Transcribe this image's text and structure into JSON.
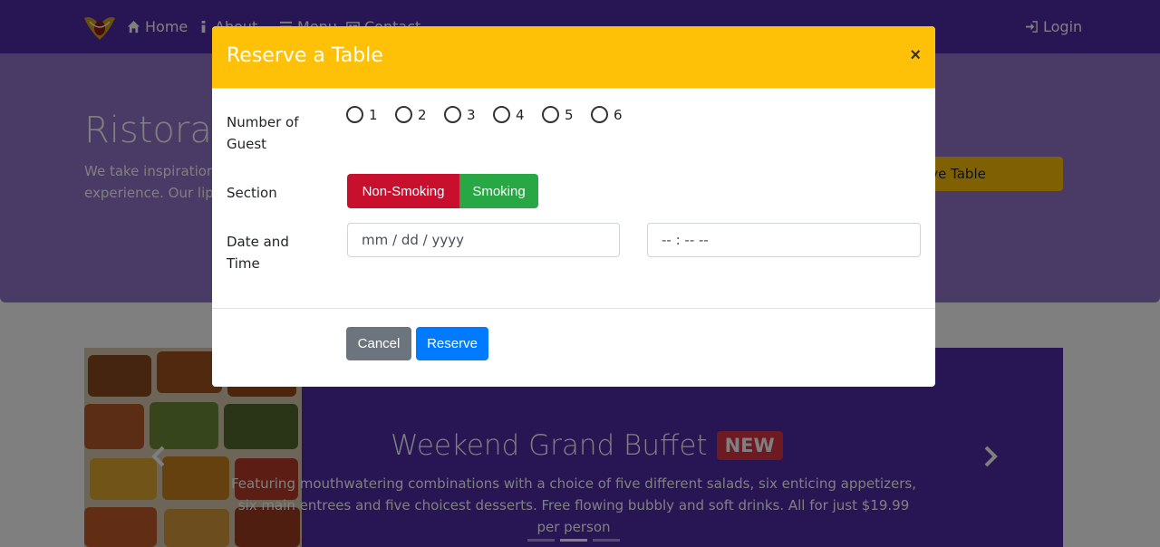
{
  "navbar": {
    "home": "Home",
    "about": "About",
    "menu": "Menu",
    "contact": "Contact",
    "login": "Login"
  },
  "jumbotron": {
    "title": "Ristorante con Fusion",
    "text": "We take inspiration from the World's best cuisines, and create a unique fusion experience. Our lipsmacking creations will tickle your culinary senses!",
    "button": "Reserve Table"
  },
  "carousel": {
    "title": "Weekend Grand Buffet",
    "badge": "NEW",
    "caption": "Featuring mouthwatering combinations with a choice of five different salads, six enticing appetizers, six main entrees and five choicest desserts. Free flowing bubbly and soft drinks. All for just $19.99 per person",
    "active_indicator": 2,
    "indicator_count": 3
  },
  "modal": {
    "title": "Reserve a Table",
    "close": "×",
    "guests_label": "Number of Guest",
    "guest_options": [
      "1",
      "2",
      "3",
      "4",
      "5",
      "6"
    ],
    "section_label": "Section",
    "section_nonsmoking": "Non-Smoking",
    "section_smoking": "Smoking",
    "datetime_label": "Date and Time",
    "date_placeholder": "mm / dd / yyyy",
    "time_placeholder": "-- : --   --",
    "cancel": "Cancel",
    "reserve": "Reserve"
  },
  "colors": {
    "navbar": "#512da8",
    "jumbotron": "#9575cd",
    "modal_header": "#ffc107",
    "nonsmoking": "#c8102e",
    "smoking": "#28a745",
    "cancel": "#6c757d",
    "reserve": "#007bff"
  }
}
